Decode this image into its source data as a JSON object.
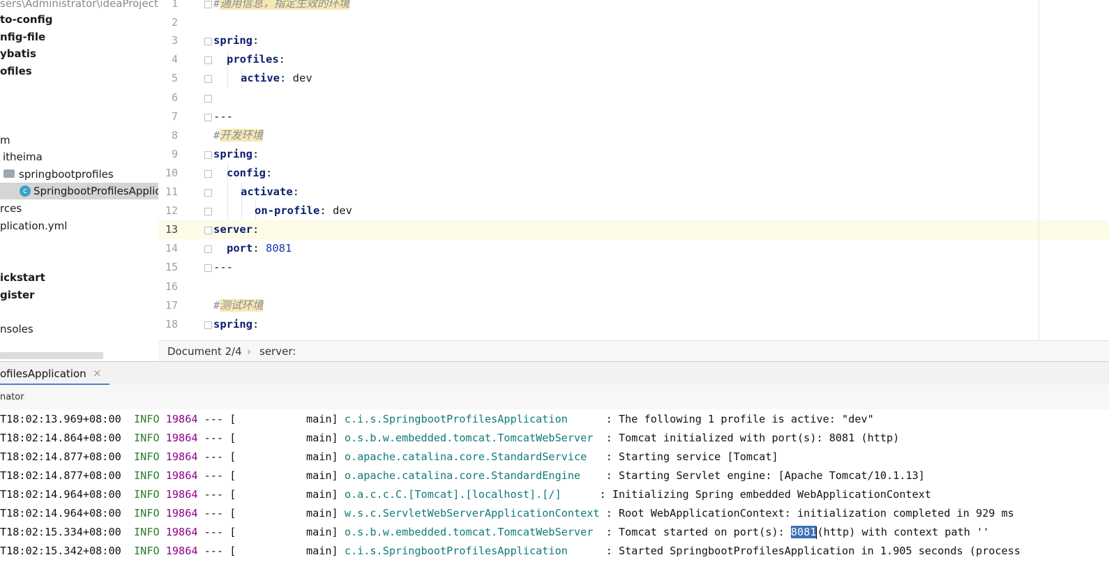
{
  "project_tree": {
    "path_text": "sers\\Administrator\\ideaProjects",
    "items": [
      {
        "label": "to-config",
        "bold": true
      },
      {
        "label": "nfig-file",
        "bold": true
      },
      {
        "label": "ybatis",
        "bold": true
      },
      {
        "label": "ofiles",
        "bold": true
      },
      {
        "label": "m",
        "bold": false
      },
      {
        "label": "itheima",
        "bold": false
      },
      {
        "label": "springbootprofiles",
        "bold": false
      },
      {
        "label": "SpringbootProfilesApplic",
        "bold": false
      },
      {
        "label": "rces",
        "bold": false
      },
      {
        "label": "plication.yml",
        "bold": false
      },
      {
        "label": "ickstart",
        "bold": true
      },
      {
        "label": "gister",
        "bold": true
      },
      {
        "label": "nsoles",
        "bold": false
      }
    ]
  },
  "editor": {
    "line_numbers": [
      "1",
      "2",
      "3",
      "4",
      "5",
      "6",
      "7",
      "8",
      "9",
      "10",
      "11",
      "12",
      "13",
      "14",
      "15",
      "16",
      "17",
      "18"
    ],
    "current_line": "13",
    "lines": [
      {
        "comment": "通用信息，指定生效的环境"
      },
      {},
      {
        "key": "spring"
      },
      {
        "key": "profiles"
      },
      {
        "key": "active",
        "value": "dev"
      },
      {},
      {
        "text": "---"
      },
      {
        "comment": "开发环境"
      },
      {
        "key": "spring"
      },
      {
        "key": "config"
      },
      {
        "key": "activate"
      },
      {
        "key": "on-profile",
        "value": "dev"
      },
      {
        "key": "server"
      },
      {
        "key": "port",
        "value": "8081"
      },
      {
        "text": "---"
      },
      {},
      {
        "comment": "测试环境"
      },
      {
        "key": "spring"
      }
    ]
  },
  "breadcrumb": {
    "document": "Document 2/4",
    "separator": "›",
    "node": "server:"
  },
  "run_panel": {
    "tab_label": "ofilesApplication",
    "close_glyph": "×",
    "toolbar_label": "nator"
  },
  "console": {
    "lines": [
      {
        "time": "T18:02:13.969+08:00",
        "level": "INFO",
        "pid": "19864",
        "sep": "--- [",
        "thread": "main]",
        "logger": "c.i.s.SpringbootProfilesApplication",
        "message": ": The following 1 profile is active: \"dev\""
      },
      {
        "time": "T18:02:14.864+08:00",
        "level": "INFO",
        "pid": "19864",
        "sep": "--- [",
        "thread": "main]",
        "logger": "o.s.b.w.embedded.tomcat.TomcatWebServer",
        "message": ": Tomcat initialized with port(s): 8081 (http)"
      },
      {
        "time": "T18:02:14.877+08:00",
        "level": "INFO",
        "pid": "19864",
        "sep": "--- [",
        "thread": "main]",
        "logger": "o.apache.catalina.core.StandardService",
        "message": ": Starting service [Tomcat]"
      },
      {
        "time": "T18:02:14.877+08:00",
        "level": "INFO",
        "pid": "19864",
        "sep": "--- [",
        "thread": "main]",
        "logger": "o.apache.catalina.core.StandardEngine",
        "message": ": Starting Servlet engine: [Apache Tomcat/10.1.13]"
      },
      {
        "time": "T18:02:14.964+08:00",
        "level": "INFO",
        "pid": "19864",
        "sep": "--- [",
        "thread": "main]",
        "logger": "o.a.c.c.C.[Tomcat].[localhost].[/]",
        "message": ": Initializing Spring embedded WebApplicationContext"
      },
      {
        "time": "T18:02:14.964+08:00",
        "level": "INFO",
        "pid": "19864",
        "sep": "--- [",
        "thread": "main]",
        "logger": "w.s.c.ServletWebServerApplicationContext",
        "message": ": Root WebApplicationContext: initialization completed in 929 ms"
      },
      {
        "time": "T18:02:15.334+08:00",
        "level": "INFO",
        "pid": "19864",
        "sep": "--- [",
        "thread": "main]",
        "logger": "o.s.b.w.embedded.tomcat.TomcatWebServer",
        "message_before": ": Tomcat started on port(s): ",
        "selected": "8081",
        "message_after": "(http) with context path ''"
      },
      {
        "time": "T18:02:15.342+08:00",
        "level": "INFO",
        "pid": "19864",
        "sep": "--- [",
        "thread": "main]",
        "logger": "c.i.s.SpringbootProfilesApplication",
        "message": ": Started SpringbootProfilesApplication in 1.905 seconds (process"
      }
    ]
  }
}
